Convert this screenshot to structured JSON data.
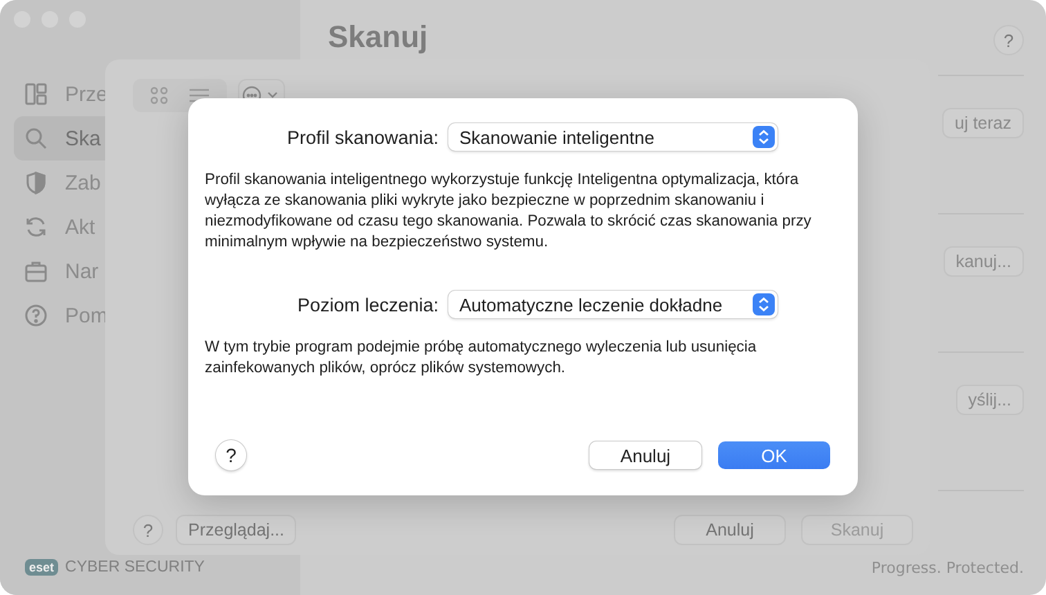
{
  "sidebar": {
    "items": [
      {
        "label": "Prze",
        "selected": false
      },
      {
        "label": "Ska",
        "selected": true
      },
      {
        "label": "Zab",
        "selected": false
      },
      {
        "label": "Akt",
        "selected": false
      },
      {
        "label": "Nar",
        "selected": false
      },
      {
        "label": "Pom",
        "selected": false
      }
    ]
  },
  "brand": {
    "logo": "eset",
    "product": "CYBER SECURITY"
  },
  "page": {
    "title": "Skanuj",
    "help": "?",
    "buttons": [
      "uj teraz",
      "kanuj...",
      "yślij..."
    ],
    "tagline": "Progress. Protected."
  },
  "scan_sheet": {
    "help": "?",
    "browse": "Przeglądaj...",
    "buttons": [
      {
        "label": "Anuluj",
        "disabled": false
      },
      {
        "label": "Skanuj",
        "disabled": true
      }
    ]
  },
  "dialog": {
    "settings": [
      {
        "label": "Profil skanowania:",
        "value": "Skanowanie inteligentne",
        "description": "Profil skanowania inteligentnego wykorzystuje funkcję Inteligentna optymalizacja, która wyłącza ze skanowania pliki wykryte jako bezpieczne w poprzednim skanowaniu i niezmodyfikowane od czasu tego skanowania. Pozwala to skrócić czas skanowania przy minimalnym wpływie na bezpieczeństwo systemu."
      },
      {
        "label": "Poziom leczenia:",
        "value": "Automatyczne leczenie dokładne",
        "description": "W tym trybie program podejmie próbę automatycznego wyleczenia lub usunięcia zainfekowanych plików, oprócz plików systemowych."
      }
    ],
    "help": "?",
    "buttons": [
      {
        "label": "Anuluj",
        "default": false
      },
      {
        "label": "OK",
        "default": true
      }
    ]
  }
}
